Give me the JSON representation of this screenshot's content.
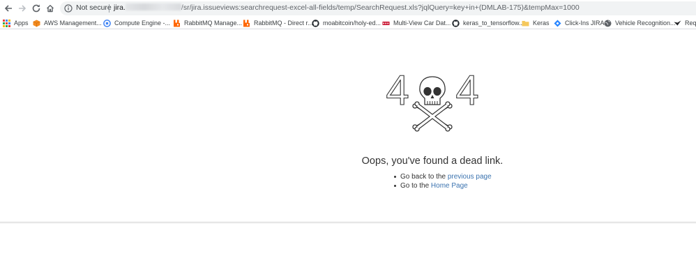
{
  "toolbar": {
    "security_label": "Not secure",
    "url_host": "jira.",
    "url_path": "/sr/jira.issueviews:searchrequest-excel-all-fields/temp/SearchRequest.xls?jqlQuery=key+in+(DMLAB-175)&tempMax=1000"
  },
  "bookmarks": [
    {
      "label": "Apps",
      "icon": "apps-grid-icon",
      "color": "#e8453c"
    },
    {
      "label": "AWS Management...",
      "icon": "aws-cube-icon",
      "color": "#f48b1f"
    },
    {
      "label": "Compute Engine -...",
      "icon": "compute-engine-icon",
      "color": "#4285f4"
    },
    {
      "label": "RabbitMQ Manage...",
      "icon": "rabbitmq-icon",
      "color": "#ff6600"
    },
    {
      "label": "RabbitMQ - Direct r...",
      "icon": "rabbitmq-icon",
      "color": "#ff6600"
    },
    {
      "label": "moabitcoin/holy-ed...",
      "icon": "github-icon",
      "color": "#24292e"
    },
    {
      "label": "Multi-View Car Dat...",
      "icon": "car-dataset-icon",
      "color": "#c8102e"
    },
    {
      "label": "keras_to_tensorflow...",
      "icon": "github-icon",
      "color": "#24292e"
    },
    {
      "label": "Keras",
      "icon": "folder-icon",
      "color": "#f5c85c"
    },
    {
      "label": "Click-Ins JIRA",
      "icon": "jira-icon",
      "color": "#2684ff"
    },
    {
      "label": "Vehicle Recognition...",
      "icon": "globe-icon",
      "color": "#5f6368"
    },
    {
      "label": "Requ",
      "icon": "request-icon",
      "color": "#202124"
    }
  ],
  "error": {
    "digit_left": "4",
    "digit_right": "4",
    "headline": "Oops, you've found a dead link.",
    "links": [
      {
        "prefix": "Go back to the",
        "link_text": "previous page"
      },
      {
        "prefix": "Go to the",
        "link_text": "Home Page"
      }
    ]
  }
}
